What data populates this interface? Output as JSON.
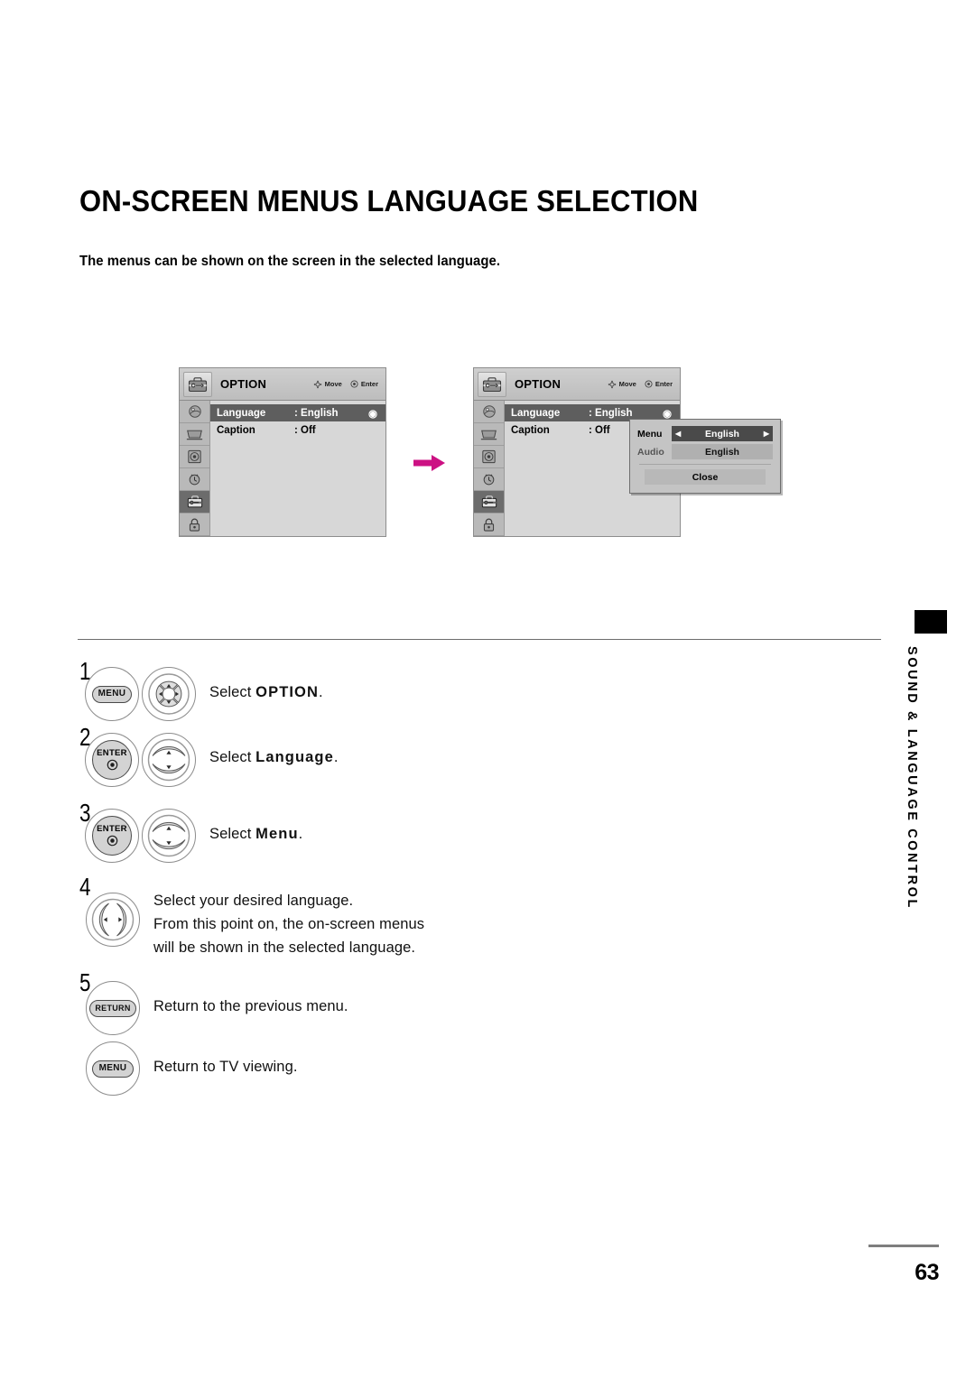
{
  "page": {
    "title": "ON-SCREEN MENUS LANGUAGE SELECTION",
    "intro": "The menus can be shown on the screen in the selected language.",
    "number": "63",
    "side_tab": "SOUND & LANGUAGE CONTROL"
  },
  "osd": {
    "title": "OPTION",
    "hints": {
      "move": "Move",
      "enter": "Enter"
    },
    "sidebar_icons": [
      "picture-icon",
      "screen-icon",
      "audio-icon",
      "time-icon",
      "option-icon",
      "lock-icon"
    ],
    "active_sidebar_index": 4,
    "rows": [
      {
        "label": "Language",
        "value": ": English",
        "mark": "◉",
        "selected": true
      },
      {
        "label": "Caption",
        "value": ": Off",
        "mark": "",
        "selected": false
      }
    ]
  },
  "popup": {
    "menu_label": "Menu",
    "menu_value": "English",
    "audio_label": "Audio",
    "audio_value": "English",
    "close_label": "Close",
    "nav_left": "◀",
    "nav_right": "▶"
  },
  "flow": {
    "arrow_color": "#CC1183"
  },
  "steps": [
    {
      "num": "1",
      "button": "MENU",
      "pad": "four-way",
      "text_prefix": "Select ",
      "text_bold": "OPTION",
      "text_suffix": "."
    },
    {
      "num": "2",
      "button": "ENTER",
      "pad": "up-down",
      "text_prefix": "Select ",
      "text_bold": "Language",
      "text_suffix": "."
    },
    {
      "num": "3",
      "button": "ENTER",
      "pad": "up-down",
      "text_prefix": "Select ",
      "text_bold": "Menu",
      "text_suffix": "."
    },
    {
      "num": "4",
      "button": "",
      "pad": "left-right",
      "lines": [
        "Select your desired language.",
        "From this point on, the on-screen menus",
        "will be shown in the selected language."
      ]
    },
    {
      "num": "5",
      "button": "RETURN",
      "pad": "",
      "text_prefix": "Return to the previous menu.",
      "text_bold": "",
      "text_suffix": ""
    },
    {
      "num": "",
      "button": "MENU",
      "pad": "",
      "text_prefix": "Return to TV viewing.",
      "text_bold": "",
      "text_suffix": ""
    }
  ],
  "labels": {
    "enter_button": "ENTER",
    "menu_button": "MENU",
    "return_button": "RETURN"
  }
}
